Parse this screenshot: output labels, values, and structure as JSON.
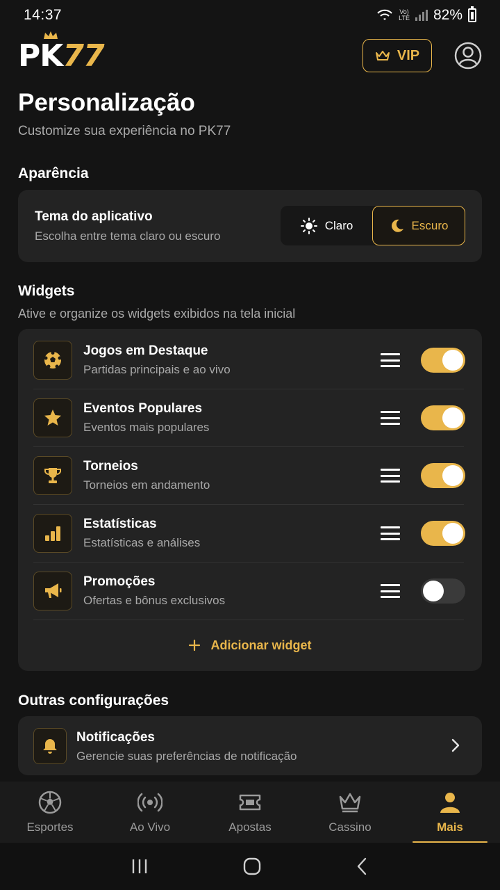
{
  "status": {
    "time": "14:37",
    "net_top": "Vo)",
    "net_bottom": "LTE",
    "battery": "82%"
  },
  "header": {
    "logo_pk": "PK",
    "logo_num": "77",
    "vip_label": "VIP"
  },
  "page": {
    "title": "Personalização",
    "subtitle": "Customize sua experiência no PK77"
  },
  "appearance": {
    "section_title": "Aparência",
    "label": "Tema do aplicativo",
    "sub": "Escolha entre tema claro ou escuro",
    "options": [
      "Claro",
      "Escuro"
    ],
    "selected": "Escuro"
  },
  "widgets": {
    "section_title": "Widgets",
    "section_sub": "Ative e organize os widgets exibidos na tela inicial",
    "items": [
      {
        "title": "Jogos em Destaque",
        "sub": "Partidas principais e ao vivo",
        "icon": "soccer-ball-icon",
        "enabled": true
      },
      {
        "title": "Eventos Populares",
        "sub": "Eventos mais populares",
        "icon": "star-icon",
        "enabled": true
      },
      {
        "title": "Torneios",
        "sub": "Torneios em andamento",
        "icon": "trophy-icon",
        "enabled": true
      },
      {
        "title": "Estatísticas",
        "sub": "Estatísticas e análises",
        "icon": "bar-chart-icon",
        "enabled": true
      },
      {
        "title": "Promoções",
        "sub": "Ofertas e bônus exclusivos",
        "icon": "megaphone-icon",
        "enabled": false
      }
    ],
    "add_label": "Adicionar widget"
  },
  "other": {
    "section_title": "Outras configurações",
    "notif_title": "Notificações",
    "notif_sub": "Gerencie suas preferências de notificação"
  },
  "nav": {
    "items": [
      "Esportes",
      "Ao Vivo",
      "Apostas",
      "Cassino",
      "Mais"
    ],
    "active": "Mais"
  },
  "colors": {
    "accent": "#e9b64b",
    "background": "#141414",
    "card": "#232323"
  }
}
